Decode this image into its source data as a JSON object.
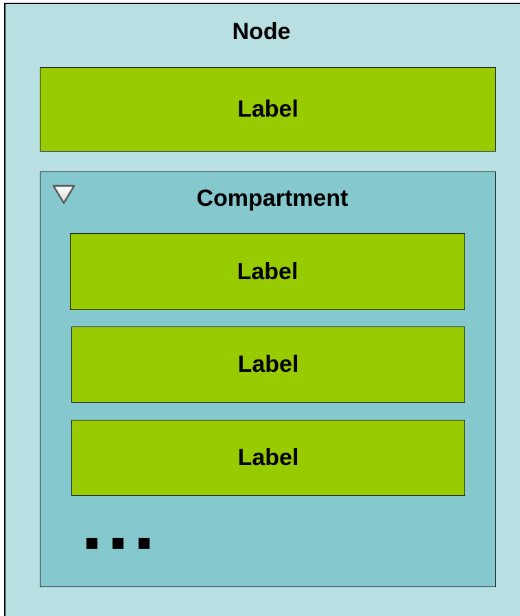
{
  "node": {
    "title": "Node",
    "label": "Label"
  },
  "compartment": {
    "title": "Compartment",
    "toggle_icon": "collapse-triangle-icon",
    "items": [
      {
        "label": "Label"
      },
      {
        "label": "Label"
      },
      {
        "label": "Label"
      }
    ],
    "more_indicator": "ellipsis-icon"
  },
  "colors": {
    "node_fill": "#b8e0e2",
    "compartment_fill": "#85c8cd",
    "label_fill": "#99cc00",
    "border": "#000000"
  }
}
